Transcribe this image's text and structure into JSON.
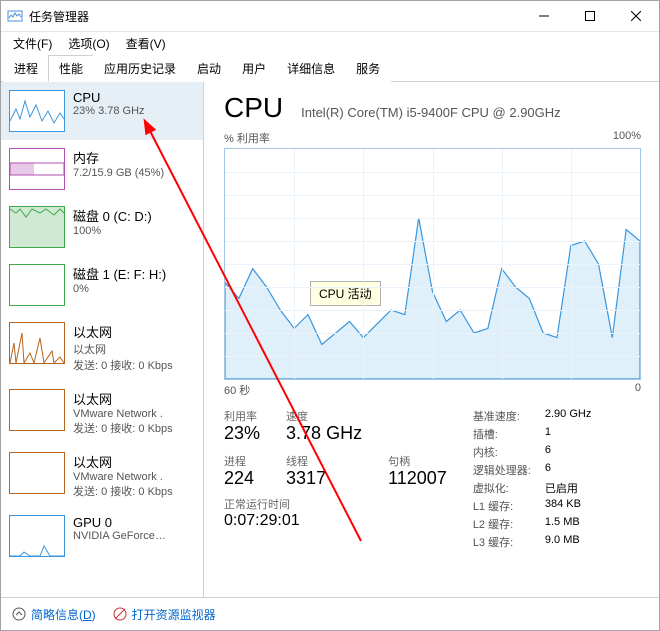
{
  "window_title": "任务管理器",
  "menus": [
    "文件(F)",
    "选项(O)",
    "查看(V)"
  ],
  "tabs": [
    "进程",
    "性能",
    "应用历史记录",
    "启动",
    "用户",
    "详细信息",
    "服务"
  ],
  "active_tab_index": 1,
  "sidebar": [
    {
      "title": "CPU",
      "sub": "23% 3.78 GHz",
      "color": "#3a96dd",
      "thumb_type": "cpu"
    },
    {
      "title": "内存",
      "sub": "7.2/15.9 GB (45%)",
      "color": "#b44fb4",
      "thumb_type": "mem"
    },
    {
      "title": "磁盘 0 (C: D:)",
      "sub": "100%",
      "color": "#3fa94e",
      "thumb_type": "disk_full"
    },
    {
      "title": "磁盘 1 (E: F: H:)",
      "sub": "0%",
      "color": "#3fa94e",
      "thumb_type": "disk_empty"
    },
    {
      "title": "以太网",
      "sub": "以太网\n发送: 0 接收: 0 Kbps",
      "color": "#b5651d",
      "thumb_type": "net"
    },
    {
      "title": "以太网",
      "sub": "VMware Network .\n发送: 0 接收: 0 Kbps",
      "color": "#b5651d",
      "thumb_type": "net_empty"
    },
    {
      "title": "以太网",
      "sub": "VMware Network .\n发送: 0 接收: 0 Kbps",
      "color": "#b5651d",
      "thumb_type": "net_empty"
    },
    {
      "title": "GPU 0",
      "sub": "NVIDIA GeForce…",
      "color": "#3a96dd",
      "thumb_type": "gpu"
    }
  ],
  "selected_sidebar_index": 0,
  "detail": {
    "heading": "CPU",
    "fullname": "Intel(R) Core(TM) i5-9400F CPU @ 2.90GHz",
    "graph_label_left": "% 利用率",
    "graph_label_right": "100%",
    "x_left": "60 秒",
    "x_right": "0",
    "tooltip": "CPU 活动",
    "grid": [
      {
        "label": "利用率",
        "value": "23%"
      },
      {
        "label": "速度",
        "value": "3.78 GHz"
      },
      {
        "label": "",
        "value": ""
      },
      {
        "label": "进程",
        "value": "224"
      },
      {
        "label": "线程",
        "value": "3317"
      },
      {
        "label": "句柄",
        "value": "112007"
      }
    ],
    "uptime_label": "正常运行时间",
    "uptime_value": "0:07:29:01",
    "right_rows": [
      {
        "k": "基准速度:",
        "v": "2.90 GHz"
      },
      {
        "k": "插槽:",
        "v": "1"
      },
      {
        "k": "内核:",
        "v": "6"
      },
      {
        "k": "逻辑处理器:",
        "v": "6"
      },
      {
        "k": "虚拟化:",
        "v": "已启用"
      },
      {
        "k": "L1 缓存:",
        "v": "384 KB"
      },
      {
        "k": "L2 缓存:",
        "v": "1.5 MB"
      },
      {
        "k": "L3 缓存:",
        "v": "9.0 MB"
      }
    ]
  },
  "footer": {
    "less": "简略信息(D)",
    "resmon": "打开资源监视器"
  },
  "chart_data": {
    "type": "area",
    "xlabel": "60 秒 → 0",
    "ylabel": "% 利用率",
    "ylim": [
      0,
      100
    ],
    "x": [
      0,
      2,
      4,
      6,
      8,
      10,
      12,
      14,
      16,
      18,
      20,
      22,
      24,
      26,
      28,
      30,
      32,
      34,
      36,
      38,
      40,
      42,
      44,
      46,
      48,
      50,
      52,
      54,
      56,
      58,
      60
    ],
    "values": [
      42,
      35,
      48,
      40,
      30,
      22,
      28,
      15,
      20,
      25,
      18,
      24,
      30,
      28,
      70,
      38,
      25,
      30,
      20,
      22,
      48,
      40,
      35,
      20,
      18,
      58,
      60,
      50,
      18,
      65,
      60
    ],
    "title": "CPU 活动"
  }
}
